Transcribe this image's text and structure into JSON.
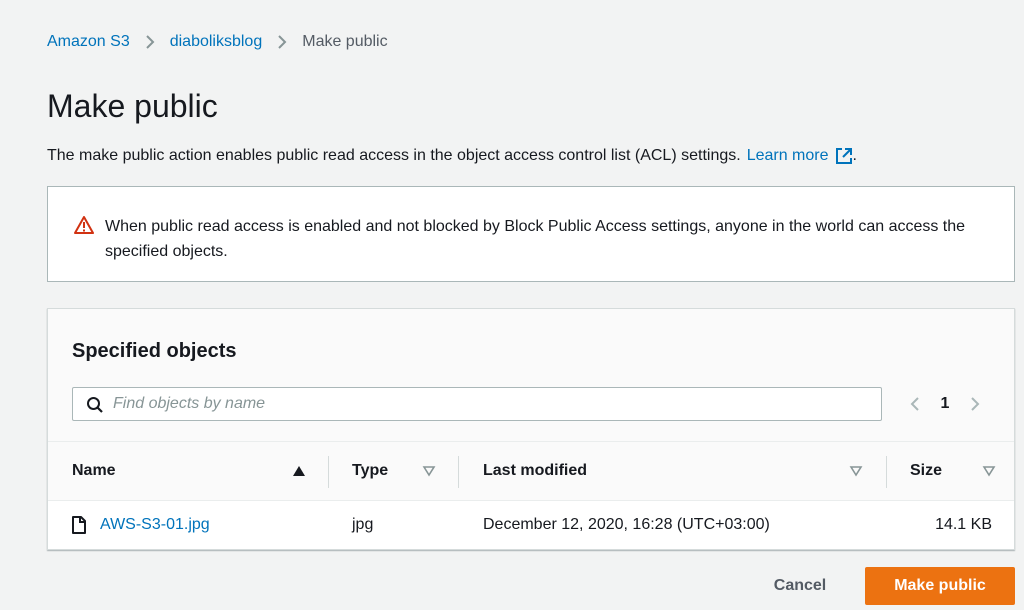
{
  "breadcrumb": {
    "items": [
      "Amazon S3",
      "diaboliksblog",
      "Make public"
    ]
  },
  "page": {
    "title": "Make public",
    "description": "The make public action enables public read access in the object access control list (ACL) settings.",
    "learn_more": "Learn more",
    "trailing_period": "."
  },
  "warning": {
    "icon": "warning-triangle-icon",
    "text": "When public read access is enabled and not blocked by Block Public Access settings, anyone in the world can access the specified objects."
  },
  "objects": {
    "title": "Specified objects",
    "search": {
      "placeholder": "Find objects by name",
      "value": ""
    },
    "pagination": {
      "current_page": "1"
    },
    "columns": [
      "Name",
      "Type",
      "Last modified",
      "Size"
    ],
    "rows": [
      {
        "name": "AWS-S3-01.jpg",
        "type": "jpg",
        "last_modified": "December 12, 2020, 16:28 (UTC+03:00)",
        "size": "14.1 KB"
      }
    ]
  },
  "footer": {
    "cancel_label": "Cancel",
    "primary_label": "Make public"
  },
  "colors": {
    "link": "#0073bb",
    "primary_button": "#ec7211",
    "warning_icon": "#d13212",
    "background": "#f2f3f3"
  }
}
